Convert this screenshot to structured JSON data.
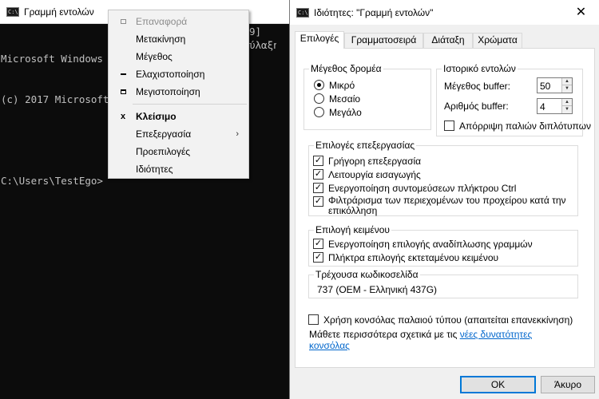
{
  "console": {
    "title": "Γραμμή εντολών",
    "lines": [
      "Microsoft Windows",
      "(c) 2017 Microsoft",
      "",
      "C:\\Users\\TestEgo>"
    ],
    "hidden_right": [
      "9]",
      "ύλαξη"
    ]
  },
  "system_menu": {
    "items": [
      {
        "label": "Επαναφορά",
        "disabled": true,
        "glyph": "restore-icon"
      },
      {
        "label": "Μετακίνηση"
      },
      {
        "label": "Μέγεθος"
      },
      {
        "label": "Ελαχιστοποίηση",
        "glyph": "minimize-icon"
      },
      {
        "label": "Μεγιστοποίηση",
        "glyph": "maximize-icon"
      },
      {
        "label": "Κλείσιμο",
        "bold": true,
        "glyph": "close-icon",
        "glyph_char": "x"
      },
      {
        "label": "Επεξεργασία",
        "submenu": true,
        "arrow": "›"
      },
      {
        "label": "Προεπιλογές"
      },
      {
        "label": "Ιδιότητες"
      }
    ]
  },
  "dialog": {
    "title": "Ιδιότητες: \"Γραμμή εντολών\"",
    "close_glyph": "✕",
    "tabs": [
      "Επιλογές",
      "Γραμματοσειρά",
      "Διάταξη",
      "Χρώματα"
    ],
    "active_tab": 0,
    "cursor_size": {
      "label": "Μέγεθος δρομέα",
      "options": [
        "Μικρό",
        "Μεσαίο",
        "Μεγάλο"
      ],
      "selected": 0
    },
    "history": {
      "label": "Ιστορικό εντολών",
      "buffer_size_label": "Μέγεθος buffer:",
      "buffer_size_value": "50",
      "buffer_count_label": "Αριθμός buffer:",
      "buffer_count_value": "4",
      "discard_label": "Απόρριψη παλιών διπλότυπων",
      "discard_checked": false
    },
    "edit_options": {
      "label": "Επιλογές επεξεργασίας",
      "items": [
        {
          "label": "Γρήγορη επεξεργασία",
          "checked": true
        },
        {
          "label": "Λειτουργία εισαγωγής",
          "checked": true
        },
        {
          "label": "Ενεργοποίηση συντομεύσεων πλήκτρου Ctrl",
          "checked": true
        },
        {
          "label": "Φιλτράρισμα των περιεχομένων του προχείρου κατά την επικόλληση",
          "checked": true
        }
      ]
    },
    "text_selection": {
      "label": "Επιλογή κειμένου",
      "items": [
        {
          "label": "Ενεργοποίηση επιλογής αναδίπλωσης γραμμών",
          "checked": true
        },
        {
          "label": "Πλήκτρα επιλογής εκτεταμένου κειμένου",
          "checked": true
        }
      ]
    },
    "codepage": {
      "label": "Τρέχουσα κωδικοσελίδα",
      "value": "737   (OEM - Ελληνική 437G)"
    },
    "legacy": {
      "label": "Χρήση κονσόλας παλαιού τύπου (απαιτείται επανεκκίνηση)",
      "checked": false
    },
    "learn_more": {
      "text": "Μάθετε περισσότερα σχετικά με τις ",
      "link": "νέες δυνατότητες κονσόλας"
    },
    "check_mark": "✓",
    "spin_up": "▲",
    "spin_down": "▼",
    "ok_label": "OK",
    "cancel_label": "Άκυρο"
  },
  "icons": {
    "cmd_icon_text": "C:\\"
  }
}
